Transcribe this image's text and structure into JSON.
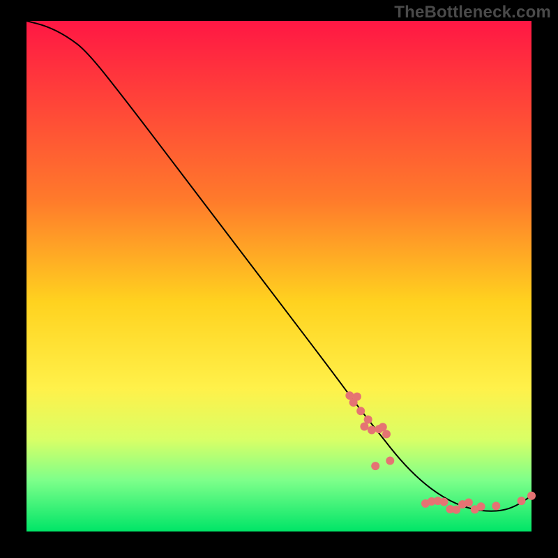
{
  "watermark": "TheBottleneck.com",
  "chart_data": {
    "type": "line",
    "title": "",
    "xlabel": "",
    "ylabel": "",
    "xlim": [
      0,
      100
    ],
    "ylim": [
      0,
      100
    ],
    "gradient_stops": [
      {
        "offset": 0,
        "color": "#ff1744"
      },
      {
        "offset": 35,
        "color": "#ff7a2b"
      },
      {
        "offset": 55,
        "color": "#ffd21f"
      },
      {
        "offset": 72,
        "color": "#fff14a"
      },
      {
        "offset": 82,
        "color": "#d9ff66"
      },
      {
        "offset": 90,
        "color": "#7dff8a"
      },
      {
        "offset": 100,
        "color": "#00e567"
      }
    ],
    "series": [
      {
        "name": "bottleneck-curve",
        "x": [
          0,
          4,
          8,
          12,
          20,
          30,
          40,
          50,
          60,
          66,
          70,
          74,
          78,
          82,
          86,
          90,
          94,
          97,
          100
        ],
        "y": [
          100,
          99,
          97,
          94,
          84,
          71,
          58,
          45,
          32,
          24,
          19,
          14,
          10,
          7,
          5,
          4,
          4,
          5,
          7
        ]
      }
    ],
    "markers": {
      "name": "sample-points",
      "color": "#e57373",
      "cluster_a": {
        "x_range": [
          64,
          72
        ],
        "count": 12,
        "y_center": 22,
        "y_jitter": 6
      },
      "cluster_b": {
        "x_range": [
          79,
          90
        ],
        "count": 10,
        "y_center": 5,
        "y_jitter": 1
      },
      "outlier": {
        "x": 93,
        "y": 5
      },
      "tail": [
        {
          "x": 98,
          "y": 6
        },
        {
          "x": 100,
          "y": 7
        }
      ]
    }
  }
}
